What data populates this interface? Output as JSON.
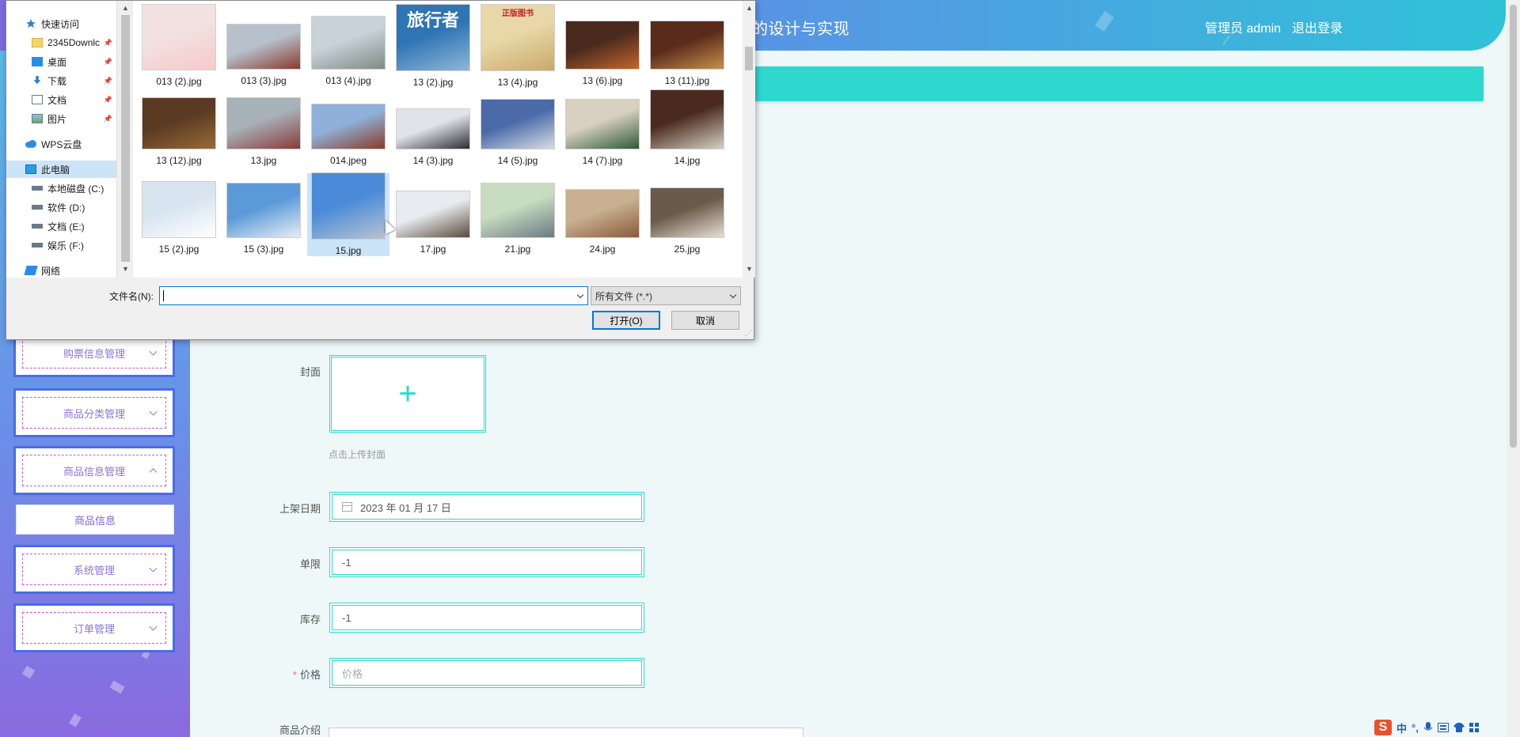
{
  "header": {
    "title": "的设计与实现",
    "user_label": "管理员 admin",
    "logout_label": "退出登录",
    "gradient_colors": [
      "#7f6ae0",
      "#5d8fe6",
      "#2fc3d8"
    ]
  },
  "sidebar": {
    "menus": [
      {
        "label": "购票信息管理",
        "expanded": false
      },
      {
        "label": "商品分类管理",
        "expanded": false
      },
      {
        "label": "商品信息管理",
        "expanded": true
      },
      {
        "label": "系统管理",
        "expanded": false
      },
      {
        "label": "订单管理",
        "expanded": false
      }
    ],
    "submenu_item": "商品信息",
    "accent_color": "#4a6ce8"
  },
  "form": {
    "cover_label": "封面",
    "cover_upload_symbol": "+",
    "cover_hint": "点击上传封面",
    "date_label": "上架日期",
    "date_value": "2023 年 01 月 17 日",
    "limit_label": "单限",
    "limit_value": "-1",
    "stock_label": "库存",
    "stock_value": "-1",
    "price_label": "价格",
    "price_required": "*",
    "price_placeholder": "价格",
    "intro_label": "商品介绍",
    "accent_color": "#2ed8cf"
  },
  "dialog": {
    "nav": [
      {
        "label": "快速访问",
        "icon": "star-icon",
        "pinned": false
      },
      {
        "label": "2345Downlc",
        "icon": "folder-icon",
        "pinned": true
      },
      {
        "label": "桌面",
        "icon": "desktop-icon",
        "pinned": true
      },
      {
        "label": "下载",
        "icon": "download-icon",
        "pinned": true
      },
      {
        "label": "文档",
        "icon": "document-icon",
        "pinned": true
      },
      {
        "label": "图片",
        "icon": "picture-icon",
        "pinned": true
      },
      {
        "label": "WPS云盘",
        "icon": "cloud-icon",
        "pinned": false
      },
      {
        "label": "此电脑",
        "icon": "computer-icon",
        "pinned": false
      },
      {
        "label": "本地磁盘 (C:)",
        "icon": "drive-icon",
        "pinned": false
      },
      {
        "label": "软件 (D:)",
        "icon": "drive-icon",
        "pinned": false
      },
      {
        "label": "文档 (E:)",
        "icon": "drive-icon",
        "pinned": false
      },
      {
        "label": "娱乐 (F:)",
        "icon": "drive-icon",
        "pinned": false
      },
      {
        "label": "网络",
        "icon": "network-icon",
        "pinned": false
      }
    ],
    "files": [
      {
        "name": "013 (2).jpg",
        "palette": [
          "#f3e1e2",
          "#f6c9c9"
        ]
      },
      {
        "name": "013 (3).jpg",
        "palette": [
          "#b6c1cc",
          "#8a3a2e"
        ]
      },
      {
        "name": "013 (4).jpg",
        "palette": [
          "#c8d2d9",
          "#7f8a86"
        ]
      },
      {
        "name": "13 (2).jpg",
        "palette": [
          "#2f74b5",
          "#8fb7d8"
        ],
        "overlay": "旅行者"
      },
      {
        "name": "13 (4).jpg",
        "palette": [
          "#e8d8a8",
          "#caa96a"
        ],
        "overlay": "正版图书"
      },
      {
        "name": "13 (6).jpg",
        "palette": [
          "#4a2a1e",
          "#c4672a"
        ]
      },
      {
        "name": "13 (11).jpg",
        "palette": [
          "#5a2a1a",
          "#c8904c"
        ]
      },
      {
        "name": "13 (12).jpg",
        "palette": [
          "#5a3a22",
          "#9a6a3a"
        ]
      },
      {
        "name": "13.jpg",
        "palette": [
          "#a8b0b8",
          "#8a3a3a"
        ]
      },
      {
        "name": "014.jpeg",
        "palette": [
          "#8fb0d8",
          "#8a3a26"
        ]
      },
      {
        "name": "14 (3).jpg",
        "palette": [
          "#e0e4e8",
          "#2a2e34"
        ]
      },
      {
        "name": "14 (5).jpg",
        "palette": [
          "#4a6aa8",
          "#d8dde4"
        ]
      },
      {
        "name": "14 (7).jpg",
        "palette": [
          "#d8d0c0",
          "#2f5a3a"
        ]
      },
      {
        "name": "14.jpg",
        "palette": [
          "#4a2a1e",
          "#d8d0c4"
        ]
      },
      {
        "name": "15 (2).jpg",
        "palette": [
          "#d8e4f0",
          "#ffffff"
        ]
      },
      {
        "name": "15 (3).jpg",
        "palette": [
          "#5a9ad8",
          "#e8eef4"
        ]
      },
      {
        "name": "15.jpg",
        "palette": [
          "#4a8ad8",
          "#b8c4d0"
        ]
      },
      {
        "name": "17.jpg",
        "palette": [
          "#e8ecf0",
          "#5a4a3a"
        ]
      },
      {
        "name": "21.jpg",
        "palette": [
          "#c8dcc0",
          "#6a7a84"
        ]
      },
      {
        "name": "24.jpg",
        "palette": [
          "#c8b090",
          "#8a5a3a"
        ]
      },
      {
        "name": "25.jpg",
        "palette": [
          "#6a5a4a",
          "#e8e0d4"
        ]
      }
    ],
    "selected_file": "15.jpg",
    "filename_label": "文件名(N):",
    "filename_value": "",
    "filetype_value": "所有文件 (*.*)",
    "open_label": "打开(O)",
    "cancel_label": "取消"
  },
  "ime": {
    "logo": "S",
    "mode": "中",
    "punct": "°,"
  }
}
